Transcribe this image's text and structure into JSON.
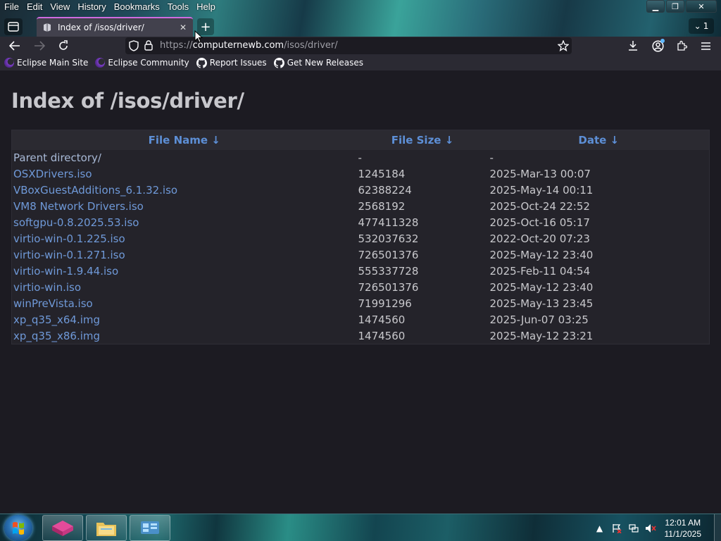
{
  "menubar": [
    "File",
    "Edit",
    "View",
    "History",
    "Bookmarks",
    "Tools",
    "Help"
  ],
  "window_controls": {
    "tablist_count": "1"
  },
  "tab": {
    "title": "Index of /isos/driver/"
  },
  "navbar": {
    "url_scheme": "https://",
    "url_host": "computernewb.com",
    "url_path": "/isos/driver/"
  },
  "bookmarks": [
    {
      "label": "Eclipse Main Site",
      "icon": "eclipse-icon"
    },
    {
      "label": "Eclipse Community",
      "icon": "eclipse-icon"
    },
    {
      "label": "Report Issues",
      "icon": "github-icon"
    },
    {
      "label": "Get New Releases",
      "icon": "github-icon"
    }
  ],
  "page": {
    "title": "Index of /isos/driver/",
    "columns": [
      "File Name  ↓",
      "File Size  ↓",
      "Date  ↓"
    ],
    "rows": [
      {
        "name": "Parent directory/",
        "size": "-",
        "date": "-"
      },
      {
        "name": "OSXDrivers.iso",
        "size": "1245184",
        "date": "2025-Mar-13 00:07"
      },
      {
        "name": "VBoxGuestAdditions_6.1.32.iso",
        "size": "62388224",
        "date": "2025-May-14 00:11"
      },
      {
        "name": "VM8 Network Drivers.iso",
        "size": "2568192",
        "date": "2025-Oct-24 22:52"
      },
      {
        "name": "softgpu-0.8.2025.53.iso",
        "size": "477411328",
        "date": "2025-Oct-16 05:17"
      },
      {
        "name": "virtio-win-0.1.225.iso",
        "size": "532037632",
        "date": "2022-Oct-20 07:23"
      },
      {
        "name": "virtio-win-0.1.271.iso",
        "size": "726501376",
        "date": "2025-May-12 23:40"
      },
      {
        "name": "virtio-win-1.9.44.iso",
        "size": "555337728",
        "date": "2025-Feb-11 04:54"
      },
      {
        "name": "virtio-win.iso",
        "size": "726501376",
        "date": "2025-May-12 23:40"
      },
      {
        "name": "winPreVista.iso",
        "size": "71991296",
        "date": "2025-May-13 23:45"
      },
      {
        "name": "xp_q35_x64.img",
        "size": "1474560",
        "date": "2025-Jun-07 03:25"
      },
      {
        "name": "xp_q35_x86.img",
        "size": "1474560",
        "date": "2025-May-12 23:21"
      }
    ]
  },
  "taskbar": {
    "time": "12:01 AM",
    "date": "11/1/2025"
  },
  "colors": {
    "link": "#6f99d8",
    "header_link": "#5d8fd6",
    "tab_accent": "#d06be0",
    "page_bg": "#1c1b22"
  }
}
